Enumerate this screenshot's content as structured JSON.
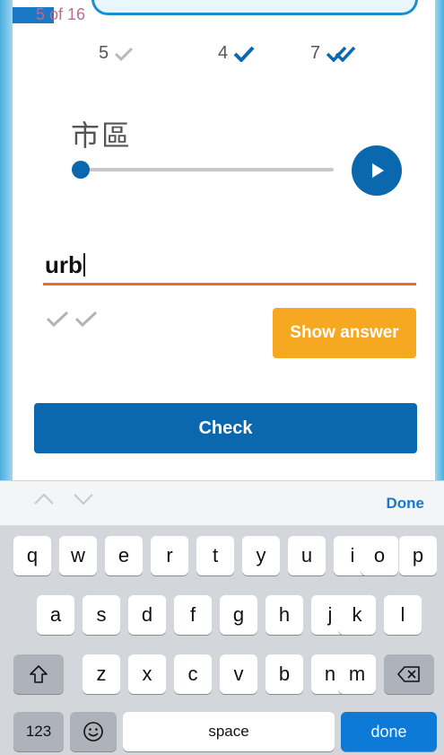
{
  "progress": {
    "text": "5 of 16"
  },
  "stats": [
    {
      "count": "5",
      "icon": "check-gray-icon"
    },
    {
      "count": "4",
      "icon": "check-blue-icon"
    },
    {
      "count": "7",
      "icon": "double-check-blue-icon"
    }
  ],
  "card": {
    "word": "市區"
  },
  "answer": {
    "value": "urb"
  },
  "buttons": {
    "show_answer": "Show answer",
    "check": "Check"
  },
  "toolbar": {
    "done": "Done"
  },
  "keyboard": {
    "row1": [
      "q",
      "w",
      "e",
      "r",
      "t",
      "y",
      "u",
      "i",
      "o",
      "p"
    ],
    "row2": [
      "a",
      "s",
      "d",
      "f",
      "g",
      "h",
      "j",
      "k",
      "l"
    ],
    "row3": [
      "z",
      "x",
      "c",
      "v",
      "b",
      "n",
      "m"
    ],
    "numbers": "123",
    "space": "space",
    "done": "done"
  },
  "colors": {
    "primary": "#0c68ae",
    "accent_orange": "#f7a823",
    "underline": "#ef6a2b"
  }
}
